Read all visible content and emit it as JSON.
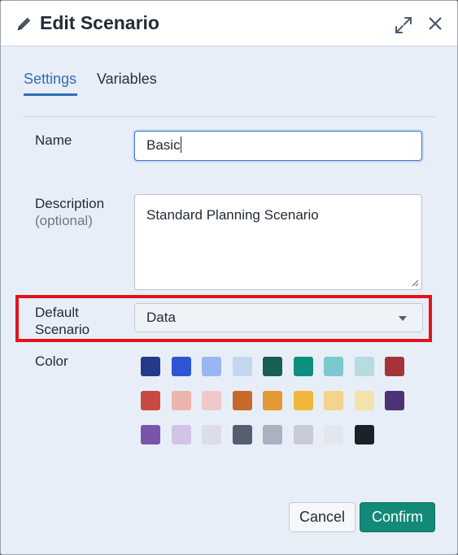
{
  "dialog": {
    "title": "Edit Scenario",
    "icons": {
      "title": "pencil-icon",
      "expand": "expand-icon",
      "close": "close-icon"
    }
  },
  "tabs": [
    {
      "label": "Settings",
      "active": true
    },
    {
      "label": "Variables",
      "active": false
    }
  ],
  "form": {
    "name_label": "Name",
    "name_value": "Basic",
    "description_label": "Description",
    "description_optional": "(optional)",
    "description_value": "Standard Planning Scenario",
    "default_scenario_label_line1": "Default",
    "default_scenario_label_line2": "Scenario",
    "default_scenario_value": "Data",
    "color_label": "Color"
  },
  "colors": [
    [
      "#233a8a",
      "#2d55d6",
      "#9ab6f0",
      "#c3d6ee",
      "#185e57",
      "#0f8f7f",
      "#7bc9ce",
      "#b6dbe0",
      "#a33536"
    ],
    [
      "#c94a43",
      "#ebb5ad",
      "#efc9c8",
      "#c8692c",
      "#e39a35",
      "#efb83a",
      "#f4d38c",
      "#f3e2ac",
      "#4c3377"
    ],
    [
      "#7854ad",
      "#d1c4e6",
      "#dcdde8",
      "#555f72",
      "#aab1c0",
      "#c8cbd6",
      "#e3e6ee",
      "#1b2129"
    ]
  ],
  "footer": {
    "cancel_label": "Cancel",
    "confirm_label": "Confirm"
  },
  "accent": "#2f6db5",
  "primary": "#138a78",
  "highlight_color": "#e0141e"
}
